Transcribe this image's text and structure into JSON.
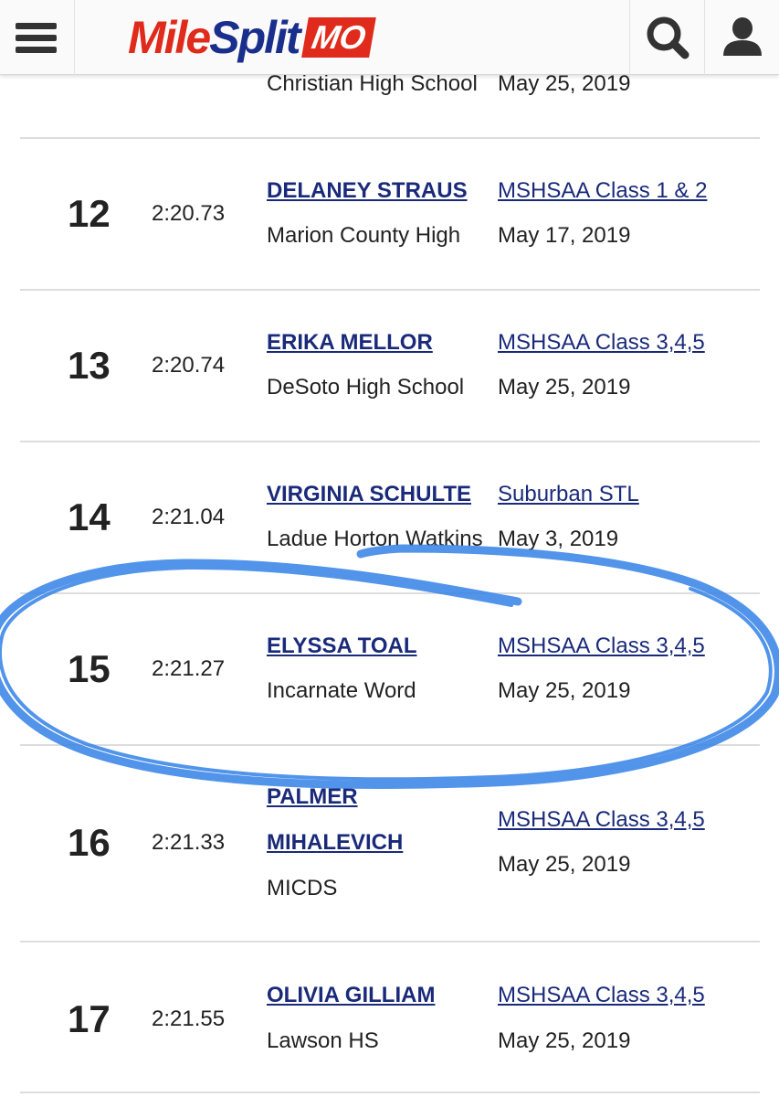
{
  "header": {
    "logo_mile": "Mile",
    "logo_split": "Split",
    "logo_badge": "MO"
  },
  "top_partial": {
    "school": "Christian High School",
    "date": "May 25, 2019"
  },
  "rows": [
    {
      "rank": "12",
      "time": "2:20.73",
      "athlete": "DELANEY STRAUS",
      "school": "Marion County High",
      "meet": "MSHSAA Class 1 & 2",
      "date": "May 17, 2019"
    },
    {
      "rank": "13",
      "time": "2:20.74",
      "athlete": "ERIKA MELLOR",
      "school": "DeSoto High School",
      "meet": "MSHSAA Class 3,4,5",
      "date": "May 25, 2019"
    },
    {
      "rank": "14",
      "time": "2:21.04",
      "athlete": "VIRGINIA SCHULTE",
      "school": "Ladue Horton Watkins",
      "meet": "Suburban STL",
      "date": "May 3, 2019"
    },
    {
      "rank": "15",
      "time": "2:21.27",
      "athlete": "ELYSSA TOAL",
      "school": "Incarnate Word",
      "meet": "MSHSAA Class 3,4,5",
      "date": "May 25, 2019"
    },
    {
      "rank": "16",
      "time": "2:21.33",
      "athlete_line1": "PALMER",
      "athlete_line2": "MIHALEVICH",
      "school": "MICDS",
      "meet": "MSHSAA Class 3,4,5",
      "date": "May 25, 2019"
    },
    {
      "rank": "17",
      "time": "2:21.55",
      "athlete": "OLIVIA GILLIAM",
      "school": "Lawson HS",
      "meet": "MSHSAA Class 3,4,5",
      "date": "May 25, 2019"
    }
  ],
  "annotation": {
    "color": "#3a86e8",
    "highlighted_rank": "15"
  }
}
